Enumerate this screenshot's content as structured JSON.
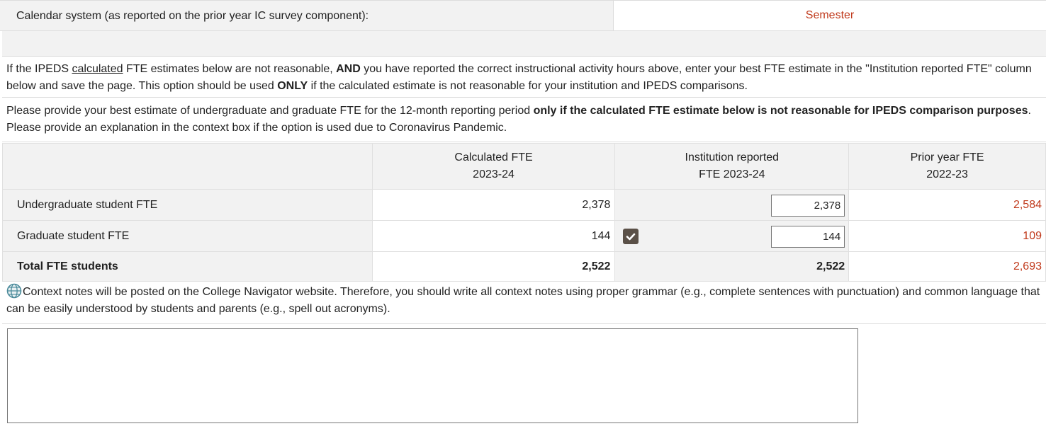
{
  "calendar": {
    "label": "Calendar system (as reported on the prior year IC survey component):",
    "value": "Semester"
  },
  "instructions": {
    "p1_a": "If the IPEDS ",
    "p1_underlined": "calculated",
    "p1_b": " FTE estimates below are not reasonable, ",
    "p1_bold1": "AND",
    "p1_c": " you have reported the correct instructional activity hours above, enter your best FTE estimate in the \"Institution reported FTE\" column below and save the page. This option should be used ",
    "p1_bold2": "ONLY",
    "p1_d": " if the calculated estimate is not reasonable for your institution and IPEDS comparisons.",
    "p2_a": "Please provide your best estimate of undergraduate and graduate FTE for the 12-month reporting period ",
    "p2_bold": "only if the calculated FTE estimate below is not reasonable for IPEDS comparison purposes",
    "p2_b": ". Please provide an explanation in the context box if the option is used due to Coronavirus Pandemic."
  },
  "table": {
    "headers": {
      "calculated_l1": "Calculated FTE",
      "calculated_l2": "2023-24",
      "institution_l1": "Institution reported",
      "institution_l2": "FTE 2023-24",
      "prior_l1": "Prior year FTE",
      "prior_l2": "2022-23"
    },
    "rows": [
      {
        "label": "Undergraduate student FTE",
        "calculated": "2,378",
        "institution": "2,378",
        "prior": "2,584"
      },
      {
        "label": "Graduate student FTE",
        "calculated": "144",
        "institution": "144",
        "prior": "109"
      }
    ],
    "total": {
      "label": "Total FTE students",
      "calculated": "2,522",
      "institution": "2,522",
      "prior": "2,693"
    }
  },
  "context_note": "Context notes will be posted on the College Navigator website. Therefore, you should write all context notes using proper grammar (e.g., complete sentences with punctuation) and common language that can be easily understood by students and parents (e.g., spell out acronyms).",
  "context_box": {
    "value": ""
  },
  "colors": {
    "prior_value": "#c0391b",
    "label_bg": "#f2f2f2",
    "checkbox": "#5a5047"
  },
  "icons": {
    "globe": "globe-icon",
    "check": "check-icon"
  }
}
